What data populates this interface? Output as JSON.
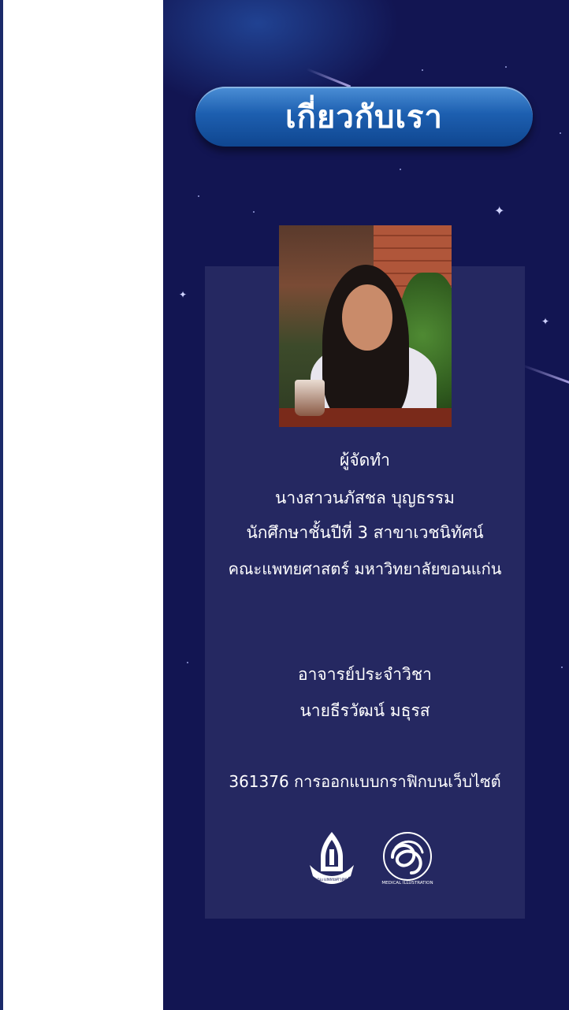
{
  "header": {
    "title": "เกี่ยวกับเรา"
  },
  "photo": {
    "alt": "ภาพผู้จัดทำ"
  },
  "maker": {
    "heading": "ผู้จัดทำ",
    "name": "นางสาวนภัสชล บุญธรรม",
    "student": "นักศึกษาชั้นปีที่ 3 สาขาเวชนิทัศน์",
    "faculty": "คณะแพทยศาสตร์ มหาวิทยาลัยขอนแก่น"
  },
  "advisor": {
    "heading": "อาจารย์ประจำวิชา",
    "name": "นายธีรวัฒน์ มธุรส"
  },
  "course": {
    "text": "361376 การออกแบบกราฟิกบนเว็บไซต์"
  },
  "logos": {
    "faculty_logo_text": "คณะแพทยศาสตร์",
    "mi_logo_text": "MEDICAL ILLUSTRATION"
  },
  "colors": {
    "panel_bg": "#121552",
    "card_bg": "#252861",
    "title_pill": "#1d5fb0",
    "text": "#ffffff"
  }
}
